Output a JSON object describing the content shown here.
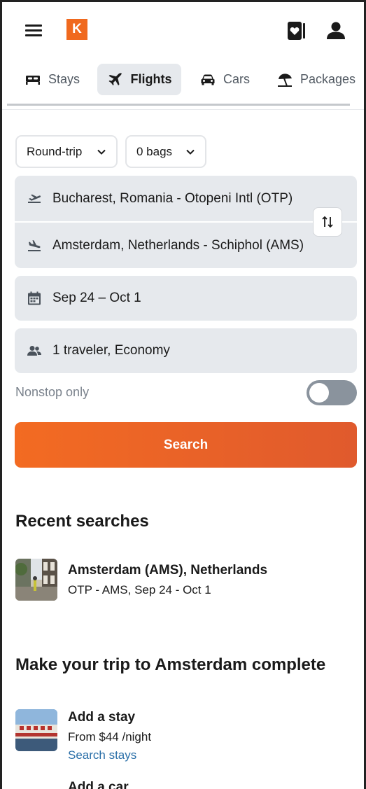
{
  "header": {
    "logo_letter": "K"
  },
  "tabs": [
    {
      "label": "Stays",
      "icon": "bed-icon",
      "active": false
    },
    {
      "label": "Flights",
      "icon": "plane-icon",
      "active": true
    },
    {
      "label": "Cars",
      "icon": "car-icon",
      "active": false
    },
    {
      "label": "Packages",
      "icon": "beach-umbrella-icon",
      "active": false
    }
  ],
  "form": {
    "trip_type": "Round-trip",
    "bags": "0 bags",
    "origin": "Bucharest, Romania - Otopeni Intl (OTP)",
    "destination": "Amsterdam, Netherlands - Schiphol (AMS)",
    "dates": "Sep 24 – Oct 1",
    "travelers": "1 traveler, Economy",
    "nonstop_label": "Nonstop only",
    "nonstop_enabled": false,
    "search_label": "Search"
  },
  "recent": {
    "title": "Recent searches",
    "items": [
      {
        "title": "Amsterdam (AMS), Netherlands",
        "subtitle": "OTP - AMS, Sep 24 - Oct 1"
      }
    ]
  },
  "trip_complete": {
    "title": "Make your trip to Amsterdam complete",
    "stay": {
      "title": "Add a stay",
      "price": "From $44 /night",
      "link": "Search stays"
    },
    "car": {
      "title": "Add a car"
    }
  },
  "colors": {
    "brand": "#f0691e",
    "search_button": "#ed6326",
    "link": "#2a6fa8",
    "field_bg": "#e6e9ed"
  }
}
